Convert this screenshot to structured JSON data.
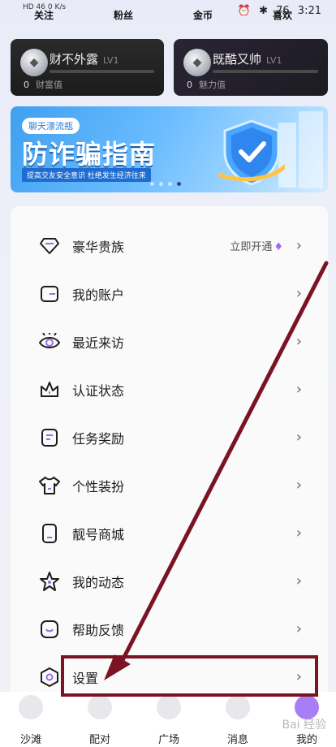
{
  "status_bar": {
    "left_text": "HD 46 0 K/s",
    "time": "3:21",
    "battery": "76"
  },
  "top_tabs": {
    "follow": "关注",
    "fans": "粉丝",
    "coins": "金币",
    "likes": "喜欢"
  },
  "cards": [
    {
      "name": "财不外露",
      "level": "LV1",
      "value": "0",
      "value_label": "财富值"
    },
    {
      "name": "既酷又帅",
      "level": "LV1",
      "value": "0",
      "value_label": "魅力值"
    }
  ],
  "banner": {
    "tag": "聊天漂流瓶",
    "title": "防诈骗指南",
    "subtitle": "提高交友安全意识 杜绝发生经济往来"
  },
  "menu": {
    "items": [
      {
        "label": "豪华贵族",
        "extra": "立即开通",
        "icon": "diamond-icon"
      },
      {
        "label": "我的账户",
        "icon": "wallet-icon"
      },
      {
        "label": "最近来访",
        "icon": "eye-icon"
      },
      {
        "label": "认证状态",
        "icon": "crown-icon"
      },
      {
        "label": "任务奖励",
        "icon": "task-icon"
      },
      {
        "label": "个性装扮",
        "icon": "tshirt-icon"
      },
      {
        "label": "靓号商城",
        "icon": "phone-icon"
      },
      {
        "label": "我的动态",
        "icon": "star-icon"
      },
      {
        "label": "帮助反馈",
        "icon": "help-icon"
      },
      {
        "label": "设置",
        "icon": "settings-icon"
      }
    ],
    "chevron": "›"
  },
  "tabbar": {
    "items": [
      "沙滩",
      "配对",
      "广场",
      "消息",
      "我的"
    ],
    "active": "我的"
  },
  "colors": {
    "accent": "#9b6bf2",
    "annotation": "#7a1424"
  },
  "watermark": "Bai 经验"
}
